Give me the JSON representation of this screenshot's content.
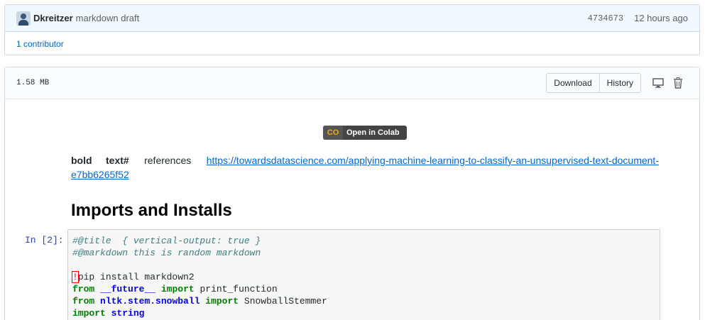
{
  "commit": {
    "author": "Dkreitzer",
    "message": "markdown draft",
    "sha": "4734673",
    "age": "12 hours ago",
    "contributors": "1 contributor"
  },
  "file": {
    "size": "1.58 MB",
    "download_label": "Download",
    "history_label": "History",
    "icons": [
      "desktop-icon",
      "trash-icon"
    ]
  },
  "notebook": {
    "colab_badge": "Open in Colab",
    "colab_logo": "CO",
    "para_bold": "bold",
    "para_text": "text#",
    "para_refs": "references",
    "link_part1": "https://towardsdatascience.com/applying-machine-learning-to-classify-an-unsupervised-text-document-",
    "link_part2": "e7bb6265f52",
    "heading": "Imports and Installs",
    "prompt": "In [2]:",
    "code": {
      "l1": "#@title  { vertical-output: true }",
      "l2": "#@markdown this is random markdown",
      "bang": "!",
      "l4_rest": "pip install markdown2",
      "from": "from",
      "import": "import",
      "future": "__future__",
      "print_function": " print_function",
      "nltk_mod": "nltk.stem.snowball",
      "stemmer": " SnowballStemmer",
      "string_mod": "string"
    }
  },
  "colors": {
    "link": "#0366d6",
    "prompt": "#303f9f",
    "keyword": "#008000",
    "comment": "#408080",
    "module": "#0000ff"
  }
}
